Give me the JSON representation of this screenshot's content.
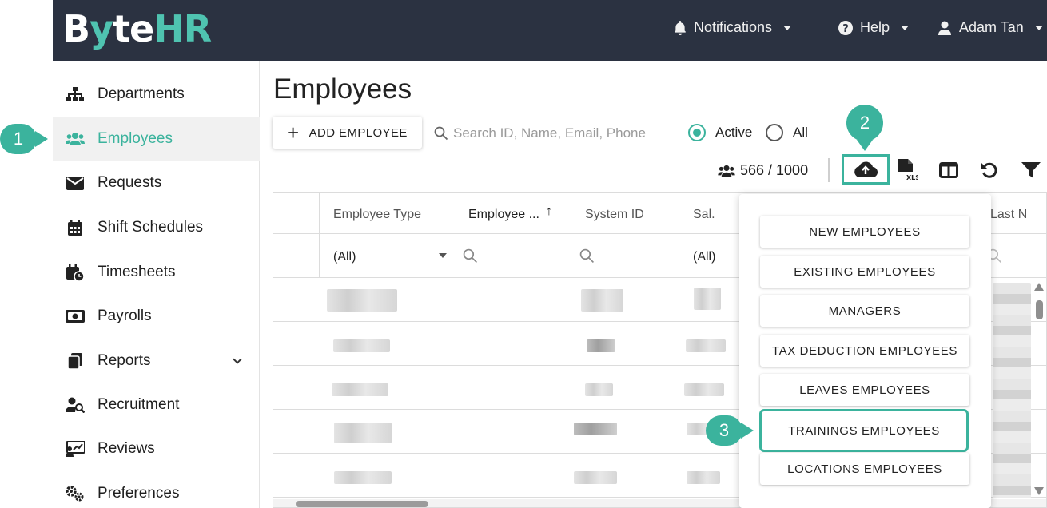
{
  "app": {
    "logo_b": "B",
    "logo_y": "y",
    "logo_te": "te",
    "logo_hr": "HR"
  },
  "topnav": {
    "notifications": "Notifications",
    "help": "Help",
    "user": "Adam Tan"
  },
  "sidebar": {
    "items": [
      {
        "label": "Departments",
        "icon": "sitemap-icon"
      },
      {
        "label": "Employees",
        "icon": "users-icon",
        "active": true
      },
      {
        "label": "Requests",
        "icon": "envelope-icon"
      },
      {
        "label": "Shift Schedules",
        "icon": "calendar-icon"
      },
      {
        "label": "Timesheets",
        "icon": "calendar-clock-icon"
      },
      {
        "label": "Payrolls",
        "icon": "money-icon"
      },
      {
        "label": "Reports",
        "icon": "copy-icon",
        "has_submenu": true
      },
      {
        "label": "Recruitment",
        "icon": "user-search-icon"
      },
      {
        "label": "Reviews",
        "icon": "chart-board-icon"
      },
      {
        "label": "Preferences",
        "icon": "gears-icon"
      }
    ]
  },
  "callouts": {
    "one": "1",
    "two": "2",
    "three": "3"
  },
  "main": {
    "title": "Employees",
    "add_button": "ADD EMPLOYEE",
    "search_placeholder": "Search ID, Name, Email, Phone",
    "radio_active": "Active",
    "radio_all": "All",
    "radio_selected": "Active",
    "count": "566 / 1000"
  },
  "grid": {
    "columns": [
      "Employee Type",
      "Employee ...",
      "System ID",
      "Sal.",
      "Last N"
    ],
    "sort_indicator": "↑",
    "filter_all": "(All)",
    "filter_all_2": "(All)"
  },
  "dropdown": {
    "items": [
      "NEW EMPLOYEES",
      "EXISTING EMPLOYEES",
      "MANAGERS",
      "TAX DEDUCTION EMPLOYEES",
      "LEAVES EMPLOYEES",
      "TRAININGS EMPLOYEES",
      "LOCATIONS EMPLOYEES"
    ],
    "highlighted": "TRAININGS EMPLOYEES"
  },
  "colors": {
    "accent": "#3bb39d",
    "topbar": "#2b3241"
  }
}
